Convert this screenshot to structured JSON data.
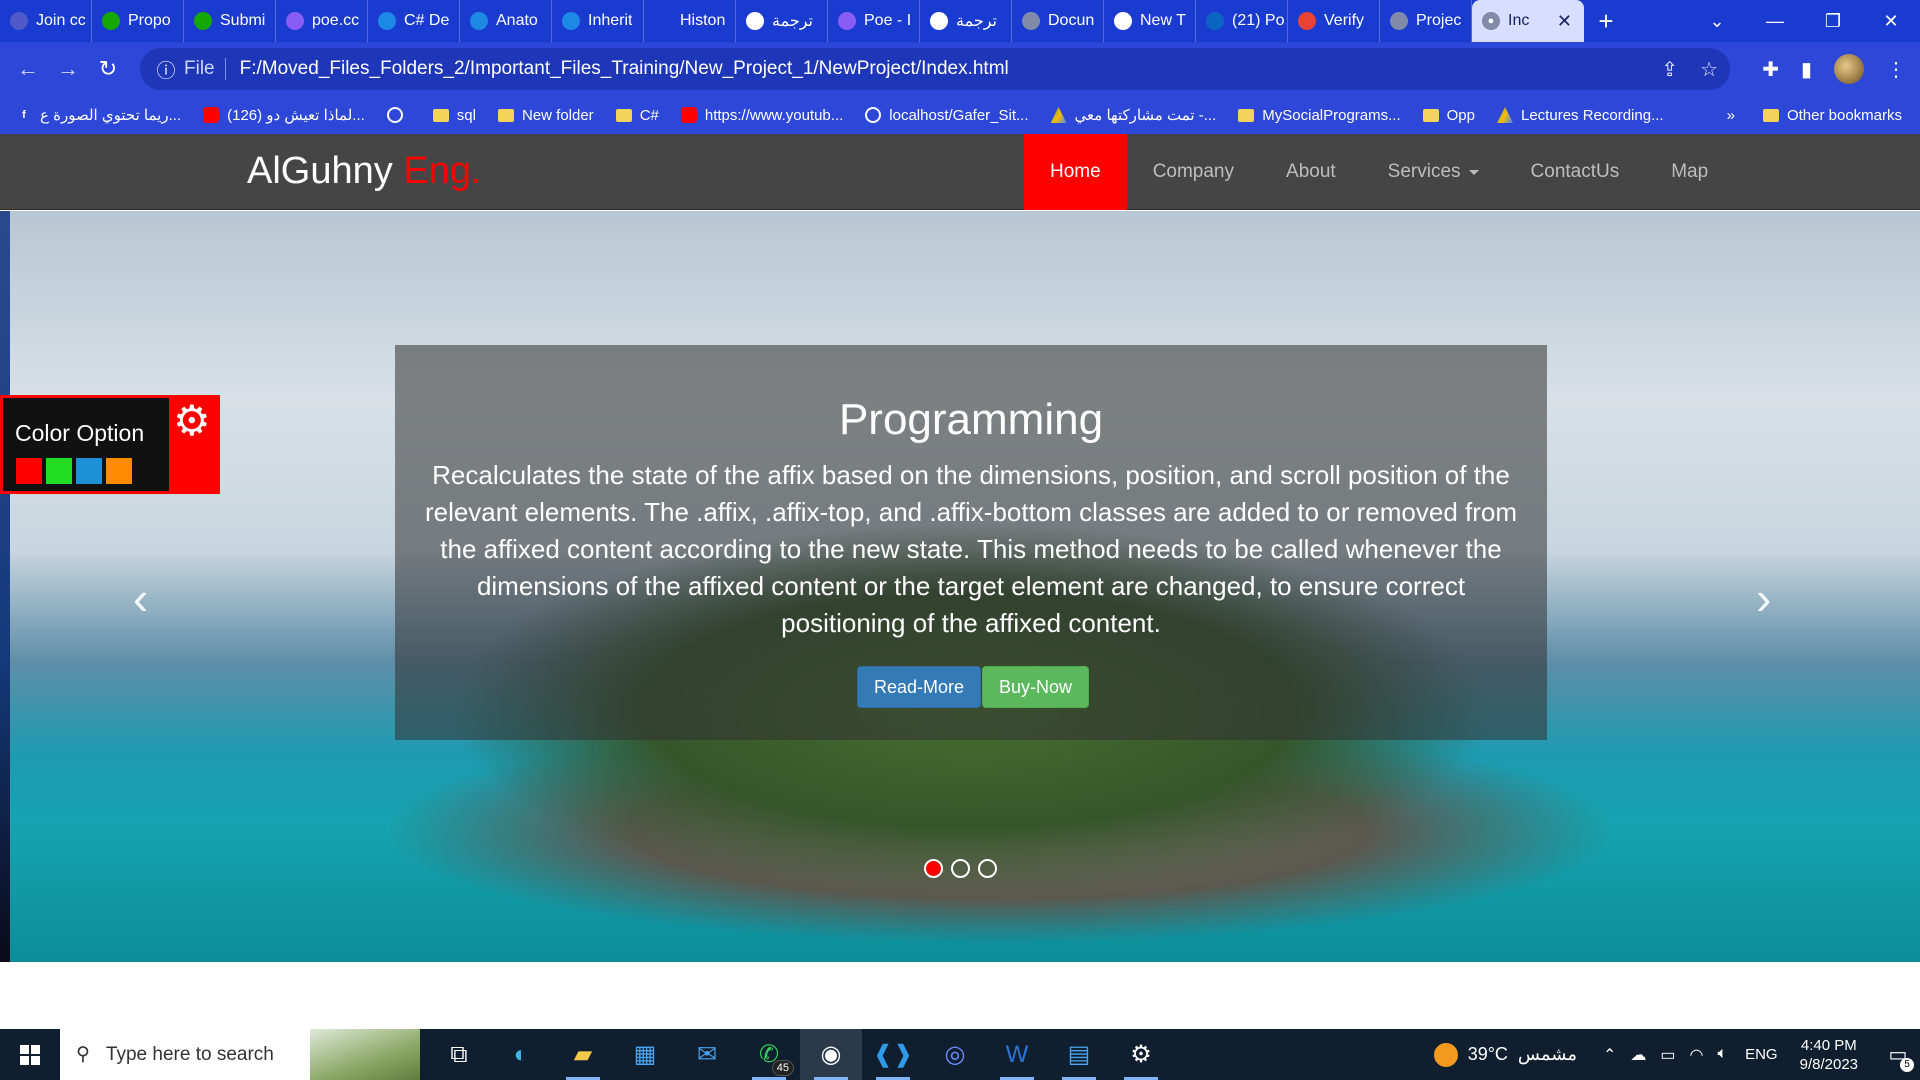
{
  "browser": {
    "tabs": [
      {
        "title": "Join cc",
        "icon": "teams-icon",
        "color": "#5059c9"
      },
      {
        "title": "Propo",
        "icon": "upwork-icon",
        "color": "#14a800"
      },
      {
        "title": "Submi",
        "icon": "upwork-icon",
        "color": "#14a800"
      },
      {
        "title": "poe.cc",
        "icon": "poe-icon",
        "color": "#8a5cf6"
      },
      {
        "title": "C# De",
        "icon": "tt-icon",
        "color": "#1e88e5"
      },
      {
        "title": "Anato",
        "icon": "tt-icon",
        "color": "#1e88e5"
      },
      {
        "title": "Inherit",
        "icon": "tt-icon",
        "color": "#1e88e5"
      },
      {
        "title": "Histon",
        "icon": "history-icon",
        "color": "#1a3bd0"
      },
      {
        "title": "ترجمة",
        "icon": "google-icon",
        "color": "#ffffff"
      },
      {
        "title": "Poe - I",
        "icon": "poe-icon",
        "color": "#8a5cf6"
      },
      {
        "title": "ترجمة",
        "icon": "google-icon",
        "color": "#ffffff"
      },
      {
        "title": "Docun",
        "icon": "globe-icon",
        "color": "#7f8ba8"
      },
      {
        "title": "New T",
        "icon": "chrome-icon",
        "color": "#ffffff"
      },
      {
        "title": "(21) Po",
        "icon": "linkedin-icon",
        "color": "#0a66c2"
      },
      {
        "title": "Verify",
        "icon": "gmail-icon",
        "color": "#ea4335"
      },
      {
        "title": "Projec",
        "icon": "globe-icon",
        "color": "#7f8ba8"
      }
    ],
    "active_tab": {
      "title": "Inc"
    },
    "window_controls": {
      "minimize": "—",
      "restore": "❐",
      "close": "✕"
    },
    "address": {
      "scheme": "File",
      "url": "F:/Moved_Files_Folders_2/Important_Files_Training/New_Project_1/NewProject/Index.html"
    },
    "bookmarks": [
      {
        "label": "ريما تحتوي الصورة ع...",
        "icon": "facebook-icon"
      },
      {
        "label": "(126) لماذا تعيش دو...",
        "icon": "youtube-icon"
      },
      {
        "label": "",
        "icon": "globe-icon"
      },
      {
        "label": "sql",
        "icon": "folder-icon"
      },
      {
        "label": "New folder",
        "icon": "folder-icon"
      },
      {
        "label": "C#",
        "icon": "folder-icon"
      },
      {
        "label": "https://www.youtub...",
        "icon": "youtube-icon"
      },
      {
        "label": "localhost/Gafer_Sit...",
        "icon": "globe-icon"
      },
      {
        "label": "تمت مشاركتها معي -...",
        "icon": "drive-icon"
      },
      {
        "label": "MySocialPrograms...",
        "icon": "folder-icon"
      },
      {
        "label": "Opp",
        "icon": "folder-icon"
      },
      {
        "label": "Lectures Recording...",
        "icon": "drive-icon"
      }
    ],
    "bookmarks_overflow": "»",
    "other_bookmarks": "Other bookmarks"
  },
  "site": {
    "brand_main": "AlGuhny",
    "brand_accent": "Eng.",
    "nav": [
      {
        "label": "Home",
        "active": true
      },
      {
        "label": "Company"
      },
      {
        "label": "About"
      },
      {
        "label": "Services",
        "dropdown": true
      },
      {
        "label": "ContactUs"
      },
      {
        "label": "Map"
      }
    ],
    "color_option": {
      "label": "Color Option",
      "swatches": [
        "#ff0000",
        "#22dd22",
        "#1e90d6",
        "#ff8c00"
      ]
    },
    "carousel": {
      "title": "Programming",
      "text": "Recalculates the state of the affix based on the dimensions, position, and scroll position of the relevant elements. The .affix, .affix-top, and .affix-bottom classes are added to or removed from the affixed content according to the new state. This method needs to be called whenever the dimensions of the affixed content or the target element are changed, to ensure correct positioning of the affixed content.",
      "read_more": "Read-More",
      "buy_now": "Buy-Now",
      "prev": "‹",
      "next": "›",
      "slide_count": 3,
      "active_slide": 1
    }
  },
  "taskbar": {
    "search_placeholder": "Type here to search",
    "whatsapp_badge": "45",
    "weather_temp": "39°C",
    "weather_text": "مشمس",
    "language": "ENG",
    "time": "4:40 PM",
    "date": "9/8/2023",
    "notifications": "5"
  }
}
